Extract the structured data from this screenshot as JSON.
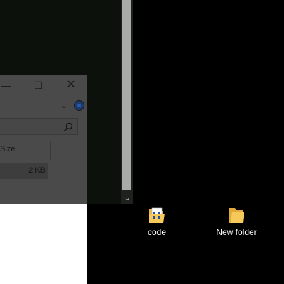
{
  "background_window": {
    "scroll_down_glyph": "⌄"
  },
  "explorer": {
    "title_buttons": {
      "minimize_glyph": "—",
      "maximize_glyph": "☐",
      "close_glyph": "✕"
    },
    "ribbon_chevron_glyph": "⌄",
    "columns": {
      "size_label": "Size"
    },
    "rows": [
      {
        "size": "2 KB"
      }
    ]
  },
  "desktop": {
    "icons": [
      {
        "label": "code",
        "icon": "folder-with-document-icon"
      },
      {
        "label": "New folder",
        "icon": "folder-icon"
      }
    ]
  },
  "colors": {
    "desktop_background": "#000000",
    "folder_yellow": "#f6c95a",
    "scroll_thumb": "#a9aba9"
  }
}
